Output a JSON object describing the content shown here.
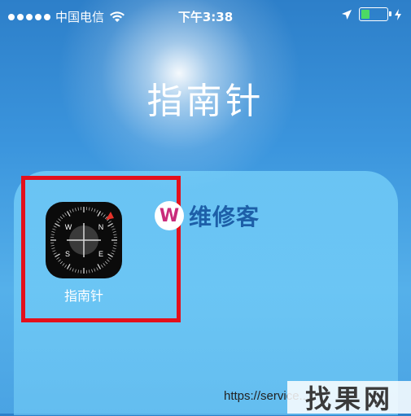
{
  "status_bar": {
    "carrier": "中国电信",
    "time": "下午3:38",
    "battery_level": 0.35,
    "battery_color": "#4cd964"
  },
  "folder": {
    "title": "指南针",
    "apps": [
      {
        "label": "指南针",
        "icon": "compass-icon"
      }
    ]
  },
  "compass": {
    "letters": [
      "N",
      "E",
      "S",
      "W"
    ]
  },
  "highlight_color": "#e3101c",
  "watermark": {
    "logo_letter": "W",
    "text": "维修客",
    "url": "https://service..."
  },
  "corner_logo": "找果网"
}
